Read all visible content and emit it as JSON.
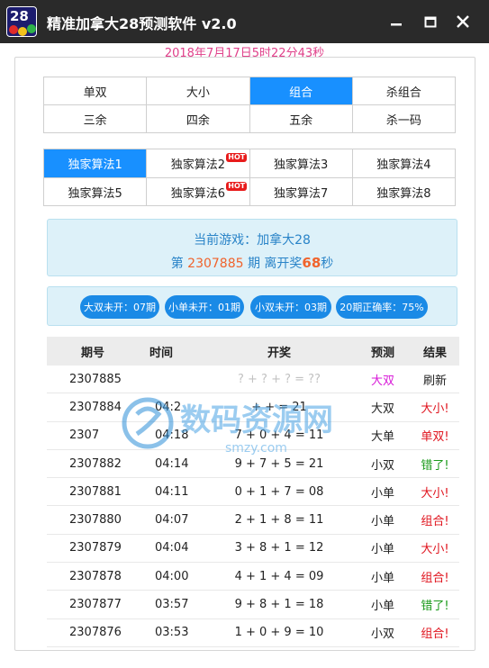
{
  "window": {
    "title": "精准加拿大28预测软件 v2.0",
    "icon_text": "28",
    "icon": "app-logo-icon",
    "controls": [
      "minimize-icon",
      "maximize-icon",
      "close-icon"
    ]
  },
  "datetime": "2018年7月17日5时22分43秒",
  "tabs_top": [
    {
      "label": "单双",
      "active": false
    },
    {
      "label": "大小",
      "active": false
    },
    {
      "label": "组合",
      "active": true
    },
    {
      "label": "杀组合",
      "active": false
    },
    {
      "label": "三余",
      "active": false
    },
    {
      "label": "四余",
      "active": false
    },
    {
      "label": "五余",
      "active": false
    },
    {
      "label": "杀一码",
      "active": false
    }
  ],
  "algorithms": [
    {
      "label": "独家算法1",
      "active": true,
      "hot": ""
    },
    {
      "label": "独家算法2",
      "active": false,
      "hot": "HOT"
    },
    {
      "label": "独家算法3",
      "active": false,
      "hot": ""
    },
    {
      "label": "独家算法4",
      "active": false,
      "hot": ""
    },
    {
      "label": "独家算法5",
      "active": false,
      "hot": ""
    },
    {
      "label": "独家算法6",
      "active": false,
      "hot": "HOT"
    },
    {
      "label": "独家算法7",
      "active": false,
      "hot": ""
    },
    {
      "label": "独家算法8",
      "active": false,
      "hot": ""
    }
  ],
  "game_info": {
    "current_game_label": "当前游戏：",
    "current_game": "加拿大28",
    "prefix": "第",
    "issue": "2307885",
    "middle": "期 离开奖",
    "seconds": "68",
    "suffix": "秒"
  },
  "stats": [
    "大双未开：07期",
    "小单未开：01期",
    "小双未开：03期",
    "20期正确率：75%"
  ],
  "table": {
    "headers": [
      "期号",
      "时间",
      "开奖",
      "预测",
      "结果"
    ],
    "rows": [
      {
        "issue": "2307885",
        "time": "",
        "draw": "? + ? + ? = ??",
        "pred": "大双",
        "result": "刷新",
        "pending": true
      },
      {
        "issue": "2307884",
        "time": "04:2",
        "draw": "+ + = 21",
        "pred": "大双",
        "result": "大小!",
        "pending": false
      },
      {
        "issue": "2307",
        "time": "04:18",
        "draw": "7 + 0 + 4 = 11",
        "pred": "大单",
        "result": "单双!",
        "pending": false
      },
      {
        "issue": "2307882",
        "time": "04:14",
        "draw": "9 + 7 + 5 = 21",
        "pred": "小双",
        "result": "错了!",
        "pending": false
      },
      {
        "issue": "2307881",
        "time": "04:11",
        "draw": "0 + 1 + 7 = 08",
        "pred": "小单",
        "result": "大小!",
        "pending": false
      },
      {
        "issue": "2307880",
        "time": "04:07",
        "draw": "2 + 1 + 8 = 11",
        "pred": "小单",
        "result": "组合!",
        "pending": false
      },
      {
        "issue": "2307879",
        "time": "04:04",
        "draw": "3 + 8 + 1 = 12",
        "pred": "小单",
        "result": "大小!",
        "pending": false
      },
      {
        "issue": "2307878",
        "time": "04:00",
        "draw": "4 + 1 + 4 = 09",
        "pred": "小单",
        "result": "组合!",
        "pending": false
      },
      {
        "issue": "2307877",
        "time": "03:57",
        "draw": "9 + 8 + 1 = 18",
        "pred": "小单",
        "result": "错了!",
        "pending": false
      },
      {
        "issue": "2307876",
        "time": "03:53",
        "draw": "1 + 0 + 9 = 10",
        "pred": "小双",
        "result": "组合!",
        "pending": false
      }
    ]
  },
  "result_colors": {
    "刷新": "#222222",
    "大小!": "#e0141e",
    "单双!": "#e0141e",
    "组合!": "#e0141e",
    "错了!": "#1a9a1a"
  },
  "colors": {
    "accent": "#1890ff",
    "pill": "#1a8ae6",
    "info_text": "#2a84c8",
    "highlight": "#f0632c",
    "datetime": "#e0408a",
    "pending_prediction": "#d81bd8"
  },
  "watermark": {
    "text": "数码资源网",
    "sub": "smzy.com"
  }
}
